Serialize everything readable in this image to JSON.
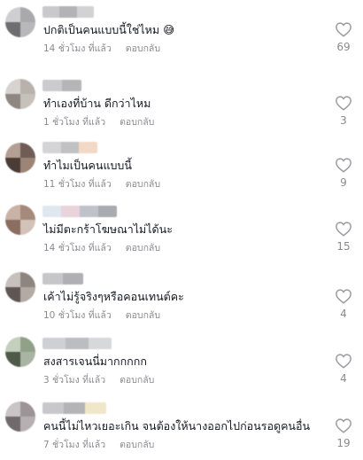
{
  "comments": [
    {
      "text": "ปกติเป็นคนแบบนี้ใช่ไหม 😅",
      "time": "14 ชั่วโมง ที่แล้ว",
      "reply": "ตอบกลับ",
      "likes": "69"
    },
    {
      "text": "ทำเองที่บ้าน ดีกว่าไหม",
      "time": "1 ชั่วโมง ที่แล้ว",
      "reply": "ตอบกลับ",
      "likes": "3"
    },
    {
      "text": "ทำไมเป็นคนแบบนี้",
      "time": "11 ชั่วโมง ที่แล้ว",
      "reply": "ตอบกลับ",
      "likes": "9"
    },
    {
      "text": "ไม่มีตะกร้าโฆษณาไม่ได้นะ",
      "time": "14 ชั่วโมง ที่แล้ว",
      "reply": "ตอบกลับ",
      "likes": "15"
    },
    {
      "text": "เค้าไม่รู้จริงๆหรือคอนเทนต์คะ",
      "time": "10 ชั่วโมง ที่แล้ว",
      "reply": "ตอบกลับ",
      "likes": "4"
    },
    {
      "text": "สงสารเจนนี่มากกกกก",
      "time": "3 ชั่วโมง ที่แล้ว",
      "reply": "ตอบกลับ",
      "likes": "4"
    },
    {
      "text": "คนนี้ไม่ไหวเยอะเกิน จนต้องให้นางออกไปก่อนรอดูคนอื่น",
      "time": "7 ชั่วโมง ที่แล้ว",
      "reply": "ตอบกลับ",
      "likes": "19"
    }
  ],
  "colors": {
    "text": "#161823",
    "secondary": "#8a8b91",
    "heart_stroke": "#9a9ba1"
  },
  "icons": {
    "like": "heart-outline-icon"
  }
}
